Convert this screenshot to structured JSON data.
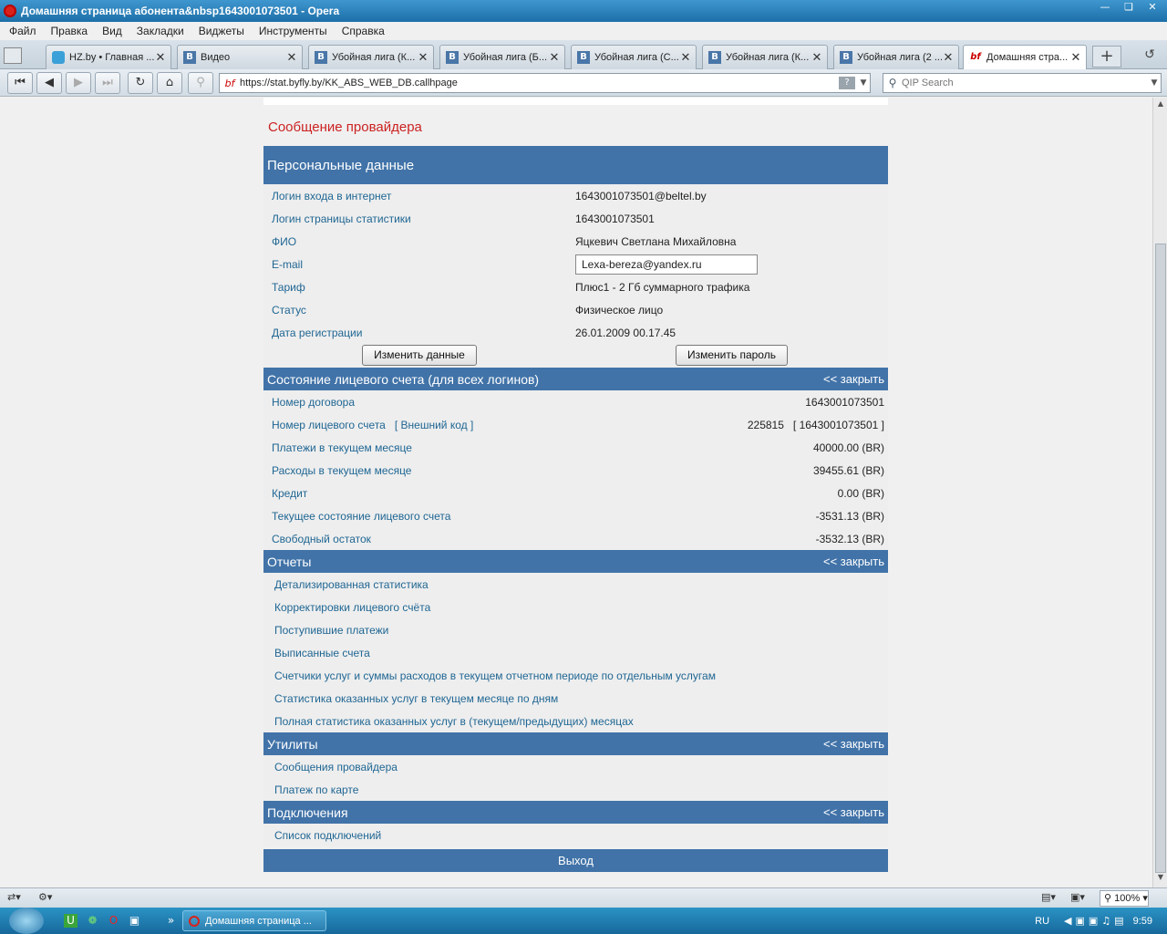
{
  "window": {
    "title": "Домашняя страница абонента&nbsp1643001073501 - Opera"
  },
  "menu": [
    "Файл",
    "Правка",
    "Вид",
    "Закладки",
    "Виджеты",
    "Инструменты",
    "Справка"
  ],
  "tabs": [
    {
      "label": "HZ.by • Главная ...",
      "icon": "hz"
    },
    {
      "label": "Видео",
      "icon": "B"
    },
    {
      "label": "Убойная лига (К...",
      "icon": "B"
    },
    {
      "label": "Убойная лига (Б...",
      "icon": "B"
    },
    {
      "label": "Убойная лига (С...",
      "icon": "B"
    },
    {
      "label": "Убойная лига (К...",
      "icon": "B"
    },
    {
      "label": "Убойная лига (2 ...",
      "icon": "B"
    },
    {
      "label": "Домашняя стра...",
      "icon": "bf"
    }
  ],
  "address": {
    "url": "https://stat.byfly.by/KK_ABS_WEB_DB.callhpage",
    "search_placeholder": "QIP Search"
  },
  "page": {
    "provider_message": "Сообщение провайдера",
    "personal": {
      "title": "Персональные данные",
      "rows": [
        {
          "label": "Логин входа в интернет",
          "value": "1643001073501@beltel.by"
        },
        {
          "label": "Логин страницы статистики",
          "value": "1643001073501"
        },
        {
          "label": "ФИО",
          "value": "Яцкевич Светлана Михайловна"
        },
        {
          "label": "E-mail",
          "value": "Lexa-bereza@yandex.ru"
        },
        {
          "label": "Тариф",
          "value": "Плюс1 - 2 Гб суммарного трафика"
        },
        {
          "label": "Статус",
          "value": "Физическое лицо"
        },
        {
          "label": "Дата регистрации",
          "value": "26.01.2009 00.17.45"
        }
      ],
      "change_data_btn": "Изменить данные",
      "change_password_btn": "Изменить пароль"
    },
    "account": {
      "title": "Состояние лицевого счета (для всех логинов)",
      "close": "<< закрыть",
      "contract_label": "Номер договора",
      "contract_value": "1643001073501",
      "account_label": "Номер лицевого счета",
      "external_code": "[ Внешний код ]",
      "account_value": "225815   [ 1643001073501 ]",
      "rows": [
        {
          "label": "Платежи в текущем месяце",
          "value": "40000.00 (BR)"
        },
        {
          "label": "Расходы в текущем месяце",
          "value": "39455.61 (BR)"
        },
        {
          "label": "Кредит",
          "value": "0.00 (BR)"
        },
        {
          "label": "Текущее состояние лицевого счета",
          "value": "-3531.13 (BR)"
        },
        {
          "label": "Свободный остаток",
          "value": "-3532.13 (BR)"
        }
      ]
    },
    "reports": {
      "title": "Отчеты",
      "close": "<< закрыть",
      "links": [
        "Детализированная статистика",
        "Корректировки лицевого счёта",
        "Поступившие платежи",
        "Выписанные счета",
        "Счетчики услуг и суммы расходов в текущем отчетном периоде по отдельным услугам",
        "Статистика оказанных услуг в текущем месяце по дням",
        "Полная статистика оказанных услуг в (текущем/предыдущих) месяцах"
      ]
    },
    "utilities": {
      "title": "Утилиты",
      "close": "<< закрыть",
      "links": [
        "Сообщения провайдера",
        "Платеж по карте"
      ]
    },
    "connections": {
      "title": "Подключения",
      "close": "<< закрыть",
      "links": [
        "Список подключений"
      ]
    },
    "logout": "Выход"
  },
  "statusbar": {
    "zoom": "100%"
  },
  "taskbar": {
    "task_label": "Домашняя страница ...",
    "lang": "RU",
    "clock": "9:59"
  }
}
